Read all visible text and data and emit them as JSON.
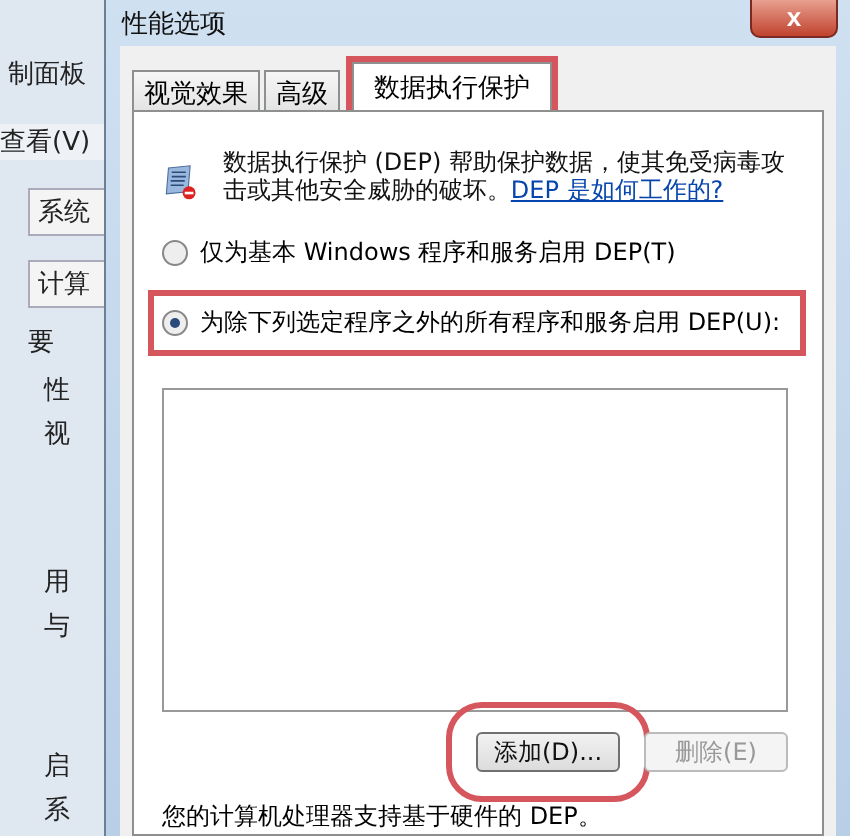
{
  "background_window": {
    "items": [
      {
        "kind": "text",
        "text": "制面板"
      },
      {
        "kind": "menu",
        "text": "查看(V)"
      },
      {
        "kind": "tab",
        "text": "系统"
      },
      {
        "kind": "tab",
        "text": "计算"
      },
      {
        "kind": "text",
        "text": "要"
      },
      {
        "kind": "text",
        "text": "性"
      },
      {
        "kind": "text",
        "text": "视"
      },
      {
        "kind": "text",
        "text": "用"
      },
      {
        "kind": "text",
        "text": "与"
      },
      {
        "kind": "text",
        "text": "启"
      },
      {
        "kind": "text",
        "text": "系"
      }
    ]
  },
  "window": {
    "title": "性能选项",
    "close": "x"
  },
  "tabs": [
    {
      "label": "视觉效果",
      "selected": false,
      "highlighted": false
    },
    {
      "label": "高级",
      "selected": false,
      "highlighted": false
    },
    {
      "label": "数据执行保护",
      "selected": true,
      "highlighted": true
    }
  ],
  "description": {
    "text": "数据执行保护 (DEP) 帮助保护数据，使其免受病毒攻击或其他安全威胁的破坏。",
    "link": "DEP 是如何工作的?"
  },
  "options": [
    {
      "label": "仅为基本 Windows 程序和服务启用 DEP(T)",
      "selected": false,
      "highlighted": false
    },
    {
      "label": "为除下列选定程序之外的所有程序和服务启用 DEP(U):",
      "selected": true,
      "highlighted": true
    }
  ],
  "buttons": [
    {
      "label": "添加(D)...",
      "disabled": false,
      "highlighted": true
    },
    {
      "label": "删除(E)",
      "disabled": true,
      "highlighted": false
    }
  ],
  "footer": "您的计算机处理器支持基于硬件的 DEP。"
}
